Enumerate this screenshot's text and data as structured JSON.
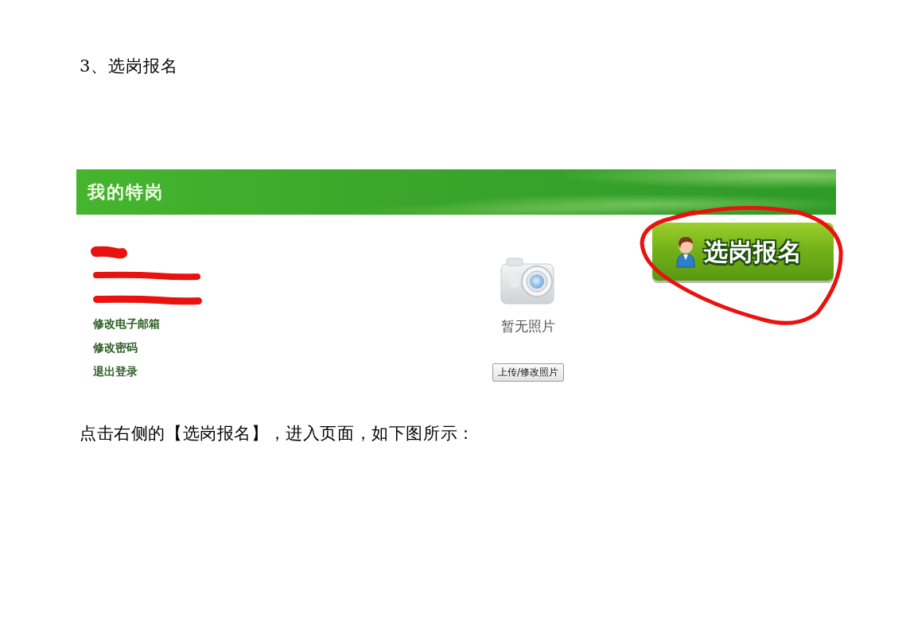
{
  "heading": "3、选岗报名",
  "screenshot": {
    "header_title": "我的特岗",
    "account_info": [
      {
        "redacted": true
      },
      {
        "redacted": true
      },
      {
        "redacted": true
      }
    ],
    "links": [
      "修改电子邮箱",
      "修改密码",
      "退出登录"
    ],
    "photo": {
      "empty_text": "暂无照片",
      "upload_button": "上传/修改照片"
    },
    "apply_button": {
      "label": "选岗报名",
      "circled": true
    }
  },
  "instruction": "点击右侧的【选岗报名】，进入页面，如下图所示："
}
